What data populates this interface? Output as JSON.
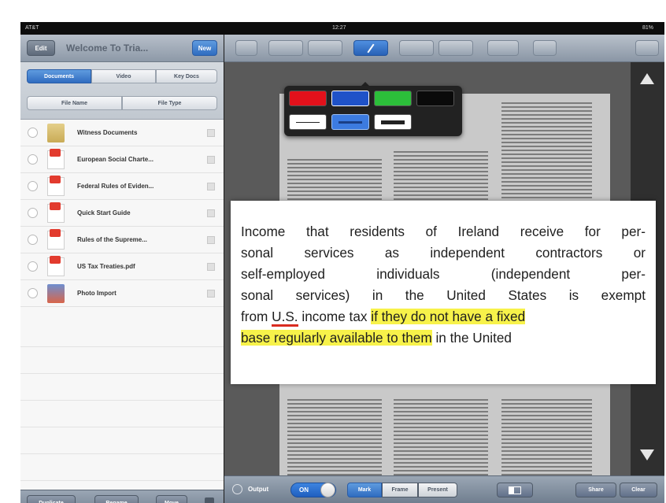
{
  "status_bar": {
    "carrier": "AT&T",
    "time": "12:27",
    "battery": "81%"
  },
  "left_panel": {
    "edit_label": "Edit",
    "title": "Welcome To Tria...",
    "new_label": "New",
    "segments": [
      "Documents",
      "Video",
      "Key Docs"
    ],
    "active_segment": 0,
    "sort_options": [
      "File Name",
      "File Type"
    ],
    "files": [
      {
        "name": "Witness Documents",
        "icon": "folder-icon"
      },
      {
        "name": "European Social Charte...",
        "icon": "pdf-icon"
      },
      {
        "name": "Federal Rules of Eviden...",
        "icon": "pdf-icon"
      },
      {
        "name": "Quick Start Guide",
        "icon": "pdf-icon"
      },
      {
        "name": "Rules of the Supreme...",
        "icon": "pdf-icon"
      },
      {
        "name": "US Tax Treaties.pdf",
        "icon": "pdf-icon"
      },
      {
        "name": "Photo Import",
        "icon": "photo-icon"
      }
    ],
    "toolbar": {
      "duplicate": "Duplicate",
      "rename": "Rename",
      "move": "Move"
    }
  },
  "palette": {
    "colors": [
      "#e2111b",
      "#1f52c8",
      "#2cbf3a",
      "#0a0a0a"
    ],
    "selected_color_index": 1,
    "line_widths": [
      "thin",
      "medium",
      "thick"
    ],
    "selected_width_index": 1
  },
  "zoom_text": {
    "line1": "Income that residents of Ireland receive for per-",
    "line2": "sonal services as independent contractors or",
    "line3": "self-employed individuals (independent per-",
    "line4": "sonal services) in the United States is exempt",
    "line5_a": "from ",
    "line5_us": "U.S.",
    "line5_b": " income tax ",
    "line5_hl": "if they do not have a fixed",
    "line6_hl": "base regularly available to them",
    "line6_b": " in the United"
  },
  "bottom_toolbar": {
    "output_label": "Output",
    "toggle": "ON",
    "modes": [
      "Mark",
      "Frame",
      "Present"
    ],
    "active_mode": 0,
    "share_label": "Share",
    "clear_label": "Clear"
  }
}
